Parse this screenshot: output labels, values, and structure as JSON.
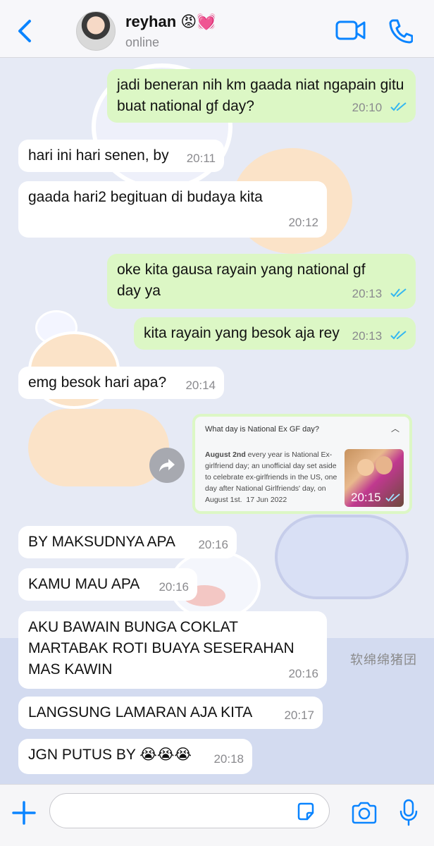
{
  "header": {
    "contact_name": "reyhan 😡💓",
    "status": "online"
  },
  "messages": [
    {
      "dir": "out",
      "text": "jadi beneran nih km gaada niat ngapain gitu buat national gf day?",
      "time": "20:10",
      "read": true
    },
    {
      "dir": "in",
      "text": "hari ini hari senen, by",
      "time": "20:11"
    },
    {
      "dir": "in",
      "text": "gaada hari2 begituan di budaya kita",
      "time": "20:12"
    },
    {
      "dir": "out",
      "text": "oke kita gausa rayain yang national gf day ya",
      "time": "20:13",
      "read": true
    },
    {
      "dir": "out",
      "text": "kita rayain yang besok aja rey",
      "time": "20:13",
      "read": true
    },
    {
      "dir": "in",
      "text": "emg besok hari apa?",
      "time": "20:14"
    },
    {
      "dir": "in",
      "text": "BY MAKSUDNYA APA",
      "time": "20:16"
    },
    {
      "dir": "in",
      "text": "KAMU MAU APA",
      "time": "20:16"
    },
    {
      "dir": "in",
      "text": "AKU BAWAIN BUNGA COKLAT MARTABAK ROTI BUAYA SESERAHAN MAS KAWIN",
      "time": "20:16"
    },
    {
      "dir": "in",
      "text": "LANGSUNG LAMARAN AJA KITA",
      "time": "20:17"
    },
    {
      "dir": "in",
      "text": "JGN PUTUS BY 😭😭😭",
      "time": "20:18"
    }
  ],
  "link_preview": {
    "question": "What day is National Ex GF day?",
    "bold": "August 2nd",
    "text": " every year is National Ex-girlfriend day; an unofficial day set aside to celebrate ex-girlfriends in the US, one day after National Girlfriends' day, on August 1st.",
    "date": "17 Jun 2022",
    "time": "20:15",
    "read": true
  },
  "wallpaper": {
    "watermark": "软绵绵猪囝"
  },
  "composer": {
    "placeholder": ""
  },
  "colors": {
    "accent": "#0a84ff",
    "outgoing": "#dcf7c5",
    "incoming": "#ffffff",
    "ticks": "#34b7f1"
  },
  "icons": [
    "back-chevron-icon",
    "video-call-icon",
    "phone-icon",
    "forward-icon",
    "plus-icon",
    "sticker-icon",
    "camera-icon",
    "mic-icon"
  ]
}
